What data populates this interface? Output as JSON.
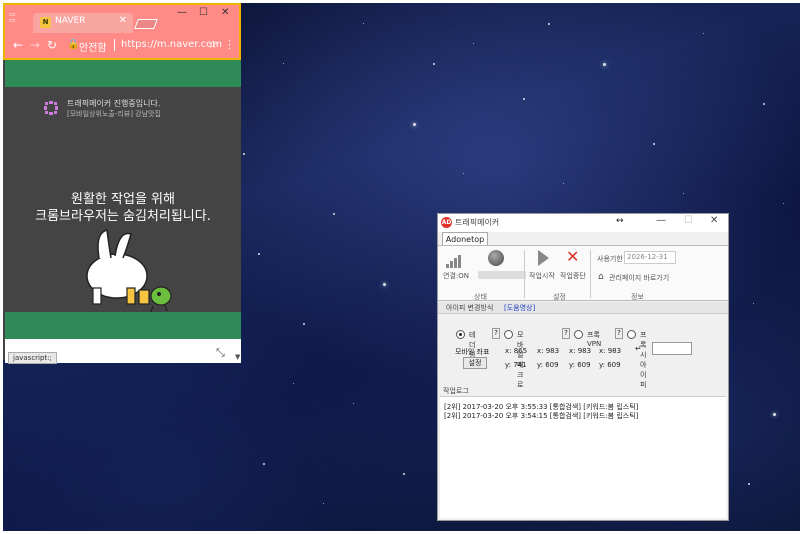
{
  "chrome": {
    "tab_title": "NAVER",
    "tab_favicon": "N",
    "secure_label": "안전함",
    "url": "https://m.naver.com",
    "page": {
      "running_text": "트래픽메이커 진행중입니다.",
      "running_sub": "[모바일상위노출-리뷰] 강남맛집",
      "notice_line1": "원활한 작업을 위해",
      "notice_line2": "크롬브라우저는 숨김처리됩니다."
    },
    "status_bar": "javascript:;"
  },
  "traffic_maker": {
    "title": "트래픽메이커",
    "ribbon_tab": "Adonetop",
    "ribbon": {
      "connection": "연결:ON",
      "group_status": "상태",
      "start": "작업시작",
      "stop": "작업중단",
      "group_settings": "설정",
      "expiry_label": "사용기한",
      "expiry_value": "2026-12-31",
      "admin_link": "관리페이지 바로가기",
      "group_info": "정보"
    },
    "section_tabs": [
      "아이피 변경방식",
      "[도움영상]"
    ],
    "ip_options": [
      {
        "label": "테더링",
        "selected": true
      },
      {
        "label": "모바일 매크로",
        "selected": false
      },
      {
        "label": "프록VPN",
        "selected": false
      },
      {
        "label": "프록시아이피",
        "selected": false
      }
    ],
    "help_mark": "?",
    "coords_label": "모바일 좌표",
    "set_button": "설정",
    "coords_x": [
      "x: 865",
      "x: 983",
      "x: 983",
      "x: 983"
    ],
    "coords_y": [
      "y: 741",
      "y: 609",
      "y: 609",
      "y: 609"
    ],
    "log_header": "작업로그",
    "log_lines": [
      "[2위] 2017-03-20 오후 3:55:33  [통합검색] [키워드:봄 립스틱]",
      "[2위] 2017-03-20 오후 3:54:15  [통합검색] [키워드:봄 립스틱]"
    ]
  },
  "colors": {
    "chrome_tab_highlight": "#ff8a86",
    "highlight_border": "#f0b400",
    "green_bar": "#2e8b57",
    "stop_red": "#d9342b",
    "link_blue": "#1a3cc8"
  },
  "icons": [
    "back-icon",
    "forward-icon",
    "reload-icon",
    "lock-icon",
    "star-icon",
    "menu-icon",
    "signal-icon",
    "globe-icon",
    "play-icon",
    "stop-icon",
    "home-icon"
  ]
}
